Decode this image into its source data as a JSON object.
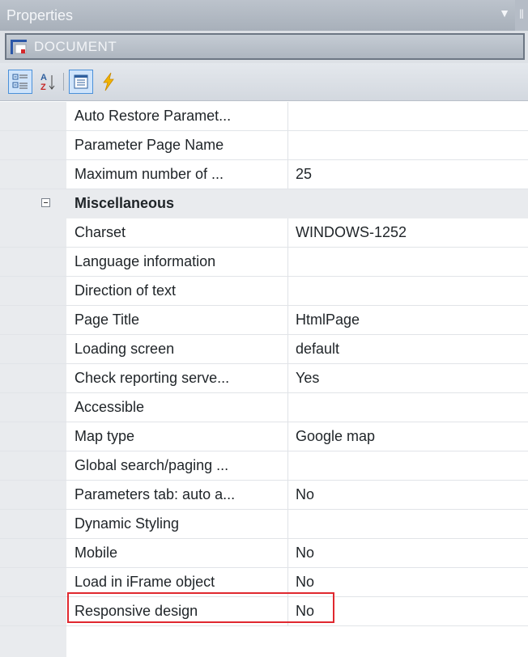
{
  "panel": {
    "title": "Properties",
    "selected_object": "DOCUMENT"
  },
  "toolbar": {
    "buttons": [
      {
        "icon": "categorized-icon",
        "active": true
      },
      {
        "icon": "alphabetical-icon",
        "active": false
      },
      {
        "icon": "property-pages-icon",
        "active": true
      },
      {
        "icon": "events-icon",
        "active": false
      }
    ]
  },
  "grid": {
    "rows_before": [
      {
        "name": "Auto Restore Paramet...",
        "value": ""
      },
      {
        "name": "Parameter Page Name",
        "value": ""
      },
      {
        "name": "Maximum number of ...",
        "value": "25"
      }
    ],
    "category": {
      "label": "Miscellaneous",
      "expanded": true
    },
    "rows": [
      {
        "name": "Charset",
        "value": "WINDOWS-1252"
      },
      {
        "name": "Language information",
        "value": ""
      },
      {
        "name": "Direction of text",
        "value": ""
      },
      {
        "name": "Page Title",
        "value": "HtmlPage"
      },
      {
        "name": "Loading screen",
        "value": "default"
      },
      {
        "name": "Check reporting serve...",
        "value": "Yes"
      },
      {
        "name": "Accessible",
        "value": ""
      },
      {
        "name": "Map type",
        "value": "Google map"
      },
      {
        "name": "Global search/paging ...",
        "value": ""
      },
      {
        "name": "Parameters tab: auto a...",
        "value": "No"
      },
      {
        "name": "Dynamic Styling",
        "value": ""
      },
      {
        "name": "Mobile",
        "value": "No"
      },
      {
        "name": "Load in iFrame object",
        "value": "No",
        "highlighted": true
      },
      {
        "name": "Responsive design",
        "value": "No"
      }
    ]
  },
  "colors": {
    "highlight_border": "#e0282f",
    "category_background": "#e9ebee",
    "titlebar": "#aeb6c0"
  }
}
